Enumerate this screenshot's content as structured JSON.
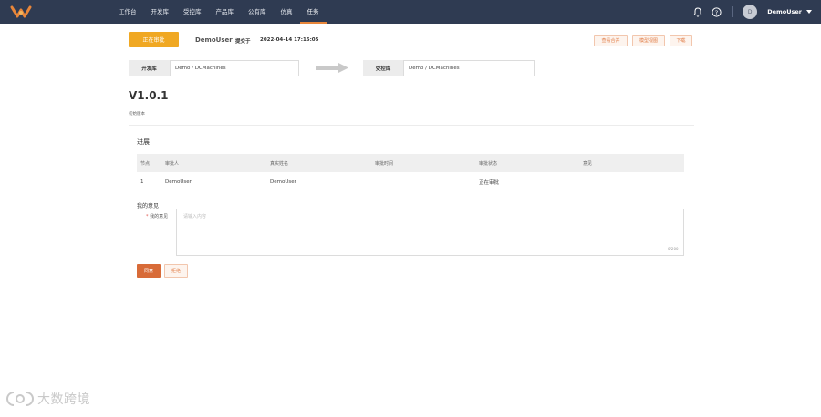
{
  "nav": {
    "items": [
      {
        "label": "工作台"
      },
      {
        "label": "开发库"
      },
      {
        "label": "受控库"
      },
      {
        "label": "产品库"
      },
      {
        "label": "公有库"
      },
      {
        "label": "仿真"
      },
      {
        "label": "任务",
        "active": true
      }
    ],
    "avatar_initial": "D",
    "username": "DemoUser"
  },
  "header": {
    "status_button": "正在审批",
    "submitter": "DemoUser",
    "submit_label": "提交于",
    "submit_time": "2022-04-14 17:15:05",
    "actions": [
      "查看合并",
      "模型视图",
      "下载"
    ]
  },
  "repos": {
    "dev_label": "开发库",
    "dev_path": "Demo / DCMachines",
    "ctrl_label": "受控库",
    "ctrl_path": "Demo / DCMachines"
  },
  "version": {
    "title": "V1.0.1",
    "desc": "初始版本"
  },
  "progress": {
    "title": "进展",
    "columns": [
      "节点",
      "审批人",
      "真实姓名",
      "审批时间",
      "审批状态",
      "意见"
    ],
    "rows": [
      {
        "node": "1",
        "approver": "DemoUser",
        "real_name": "DemoUser",
        "time": "",
        "status": "正在审批",
        "comment": ""
      }
    ]
  },
  "opinion": {
    "title": "我的意见",
    "required_mark": "*",
    "label": "我的意见",
    "placeholder": "请输入内容",
    "counter": "0/200"
  },
  "buttons": {
    "pass": "同意",
    "reject": "拒绝"
  },
  "watermark": {
    "text": "大数跨境"
  },
  "colors": {
    "nav_bg": "#2f3b52",
    "accent_orange": "#e8863a",
    "status_yellow": "#f0a823",
    "primary_button": "#d86b38"
  }
}
